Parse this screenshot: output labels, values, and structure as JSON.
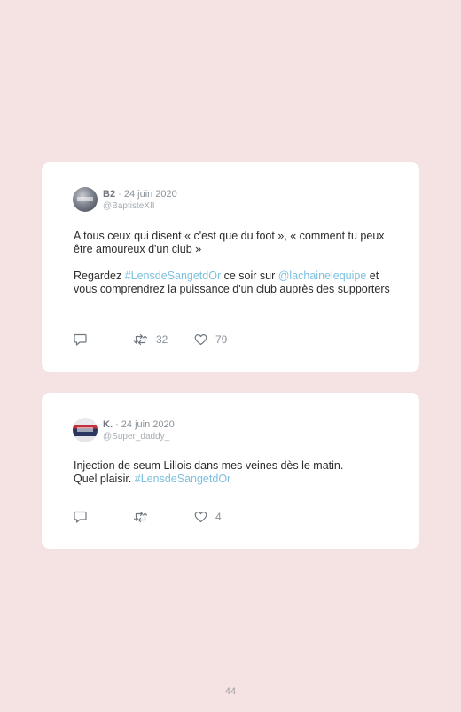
{
  "tweets": [
    {
      "name": "B2",
      "date": "· 24 juin 2020",
      "handle": "@BaptisteXII",
      "p1": "A tous ceux qui disent « c'est que du foot », « comment tu peux être amoureux d'un club »",
      "p2_a": "Regardez ",
      "p2_tag": "#LensdeSangetdOr",
      "p2_b": " ce soir sur ",
      "p2_mention": "@lachainelequipe",
      "p2_c": " et vous comprendrez la puissance d'un club auprès des supporters",
      "retweets": "32",
      "likes": "79",
      "icons": [
        "reply-icon",
        "retweet-icon",
        "like-icon"
      ]
    },
    {
      "name": "K.",
      "date": "· 24 juin 2020",
      "handle": "@Super_daddy_",
      "l1": "Injection de seum Lillois dans mes veines dès le matin.",
      "l2_a": "Quel plaisir. ",
      "l2_tag": "#LensdeSangetdOr",
      "likes": "4",
      "icons": [
        "reply-icon",
        "retweet-icon",
        "like-icon"
      ]
    }
  ],
  "page_number": "44",
  "colors": {
    "background": "#f5e3e3",
    "card": "#ffffff",
    "hashtag": "#7cc0df",
    "text": "#2b2b2b",
    "muted": "#8a9299"
  }
}
